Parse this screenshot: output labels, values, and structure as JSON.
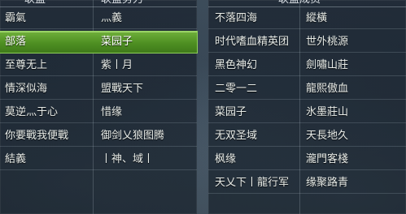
{
  "left_panel": {
    "headers": [
      "联盟",
      "联盟势力"
    ],
    "rows": [
      {
        "name": "霸氣",
        "leader": "灬義",
        "selected": false
      },
      {
        "name": "部落",
        "leader": "菜园子",
        "selected": true
      },
      {
        "name": "至尊无上",
        "leader": "紫丨月",
        "selected": false
      },
      {
        "name": "情深似海",
        "leader": "盟戰天下",
        "selected": false
      },
      {
        "name": "莫逆灬于心",
        "leader": "惜缘",
        "selected": false
      },
      {
        "name": "你要戰我便戰",
        "leader": "御剑乂狼图腾",
        "selected": false
      },
      {
        "name": "結義",
        "leader": "丨神、域丨",
        "selected": false
      }
    ]
  },
  "right_panel": {
    "header": "联盟成员",
    "rows": [
      {
        "a": "不落四海",
        "b": "縱橫"
      },
      {
        "a": "时代嗜血精英团",
        "b": "世外桃源"
      },
      {
        "a": "黑色神幻",
        "b": "劍嘯山莊"
      },
      {
        "a": "二零一二",
        "b": "龍熙傲血"
      },
      {
        "a": "菜园子",
        "b": "氷墨莊山"
      },
      {
        "a": "无双圣域",
        "b": "天長地久"
      },
      {
        "a": "枫缘",
        "b": "瀧門客棧"
      },
      {
        "a": "天乂下丨龍行军",
        "b": "缘聚路青"
      }
    ]
  },
  "colors": {
    "selected_green": "#4e8f22",
    "text": "#e8ece8"
  }
}
